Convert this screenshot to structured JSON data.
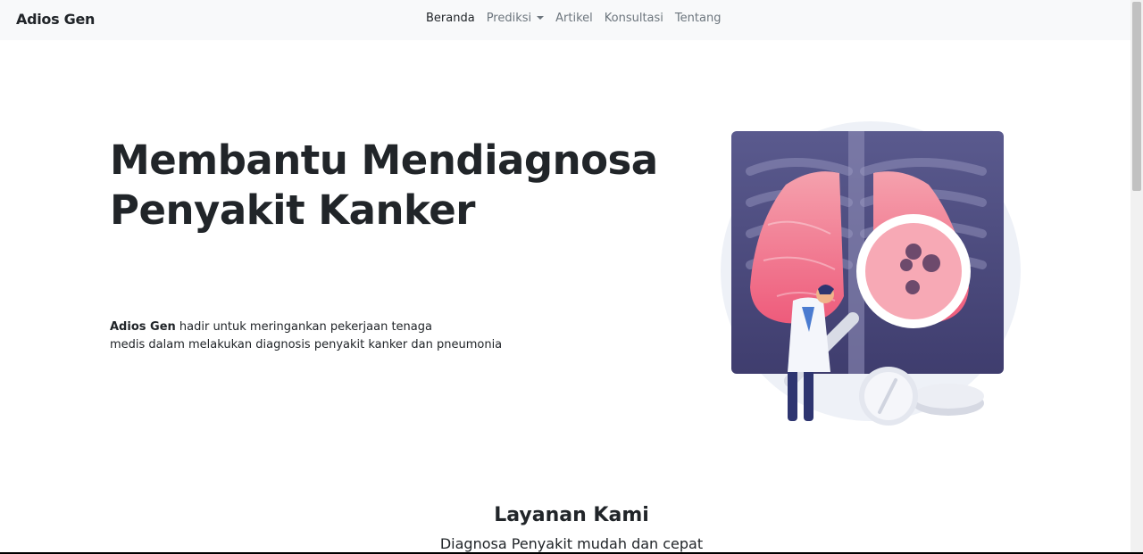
{
  "nav": {
    "brand": "Adios Gen",
    "items": [
      {
        "label": "Beranda",
        "active": true,
        "dropdown": false
      },
      {
        "label": "Prediksi",
        "active": false,
        "dropdown": true
      },
      {
        "label": "Artikel",
        "active": false,
        "dropdown": false
      },
      {
        "label": "Konsultasi",
        "active": false,
        "dropdown": false
      },
      {
        "label": "Tentang",
        "active": false,
        "dropdown": false
      }
    ]
  },
  "hero": {
    "title_line1": "Membantu Mendiagnosa",
    "title_line2": "Penyakit Kanker",
    "desc_brand": "Adios Gen",
    "desc_line1_rest": " hadir untuk meringankan pekerjaan tenaga",
    "desc_line2": "medis dalam melakukan diagnosis penyakit kanker dan pneumonia",
    "illustration_icon": "doctor-xray-lungs-illustration"
  },
  "services": {
    "title": "Layanan Kami",
    "subtitle": "Diagnosa Penyakit mudah dan cepat"
  },
  "colors": {
    "navbar_bg": "#f8f9fa",
    "text": "#212529",
    "muted": "#6c757d",
    "xray_dark": "#4f4d7d",
    "lung_pink": "#f06a84"
  }
}
